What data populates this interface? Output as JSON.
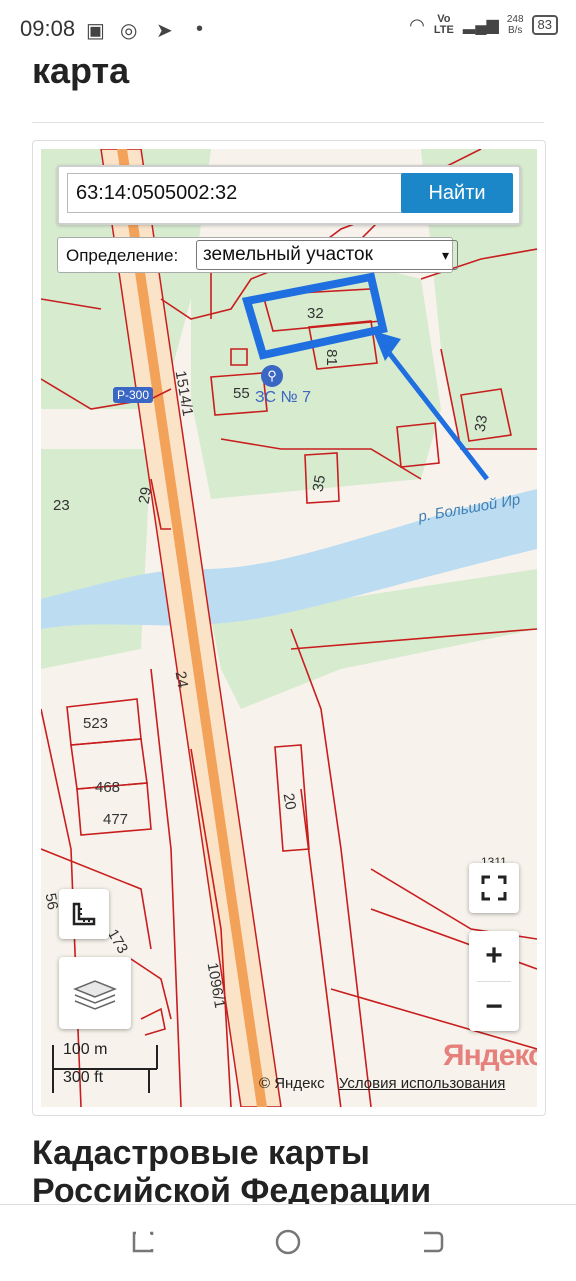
{
  "status_bar": {
    "time": "09:08",
    "network_type": "Vo LTE",
    "speed_value": "248",
    "speed_unit": "B/s",
    "battery": "83"
  },
  "page": {
    "heading": "карта",
    "bottom_heading": "Кадастровые карты Российской Федерации"
  },
  "map": {
    "search_value": "63:14:0505002:32",
    "search_button": "Найти",
    "definition_label": "Определение:",
    "definition_selected": "земельный участок",
    "parcel_labels": [
      "32",
      "81",
      "55",
      "33",
      "35",
      "23",
      "29",
      "1514/1",
      "24",
      "523",
      "468",
      "477",
      "20",
      "173",
      "1096/1",
      "56",
      "1311"
    ],
    "station_label": "ЗС № 7",
    "river_label": "р. Большой Ир",
    "road_shield": "Р-300",
    "zoom_in": "+",
    "zoom_out": "−",
    "scale_metric": "100 m",
    "scale_imperial": "300 ft",
    "copyright": "© Яндекс",
    "terms_link": "Условия использования",
    "logo": "Яндекс"
  },
  "colors": {
    "accent_button": "#1b86c8",
    "parcel_line": "#c81e1e",
    "annotation": "#1f6fe0",
    "water": "#bcdcf2",
    "green": "#d7ebcf",
    "road": "#f3a25a"
  }
}
